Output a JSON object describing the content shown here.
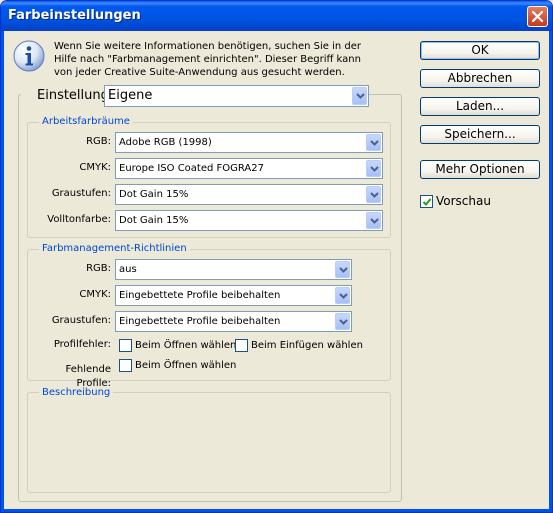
{
  "window": {
    "title": "Farbeinstellungen"
  },
  "info": {
    "text": "Wenn Sie weitere Informationen benötigen, suchen Sie in der Hilfe nach \"Farbmanagement einrichten\". Dieser Begriff kann von jeder Creative Suite-Anwendung aus gesucht werden."
  },
  "buttons": {
    "ok": "OK",
    "cancel": "Abbrechen",
    "load": "Laden...",
    "save": "Speichern...",
    "more": "Mehr Optionen"
  },
  "preview": {
    "label": "Vorschau",
    "checked": true
  },
  "setting": {
    "label": "Einstellung:",
    "value": "Eigene"
  },
  "working_spaces": {
    "title": "Arbeitsfarbräume",
    "rgb": {
      "label": "RGB:",
      "value": "Adobe RGB (1998)"
    },
    "cmyk": {
      "label": "CMYK:",
      "value": "Europe ISO Coated FOGRA27"
    },
    "gray": {
      "label": "Graustufen:",
      "value": "Dot Gain 15%"
    },
    "spot": {
      "label": "Volltonfarbe:",
      "value": "Dot Gain 15%"
    }
  },
  "policies": {
    "title": "Farbmanagement-Richtlinien",
    "rgb": {
      "label": "RGB:",
      "value": "aus"
    },
    "cmyk": {
      "label": "CMYK:",
      "value": "Eingebettete Profile beibehalten"
    },
    "gray": {
      "label": "Graustufen:",
      "value": "Eingebettete Profile beibehalten"
    },
    "mismatch": {
      "label": "Profilfehler:",
      "ask_open": "Beim Öffnen wählen",
      "ask_paste": "Beim Einfügen wählen"
    },
    "missing": {
      "label": "Fehlende Profile:",
      "ask_open": "Beim Öffnen wählen"
    }
  },
  "description": {
    "title": "Beschreibung"
  }
}
